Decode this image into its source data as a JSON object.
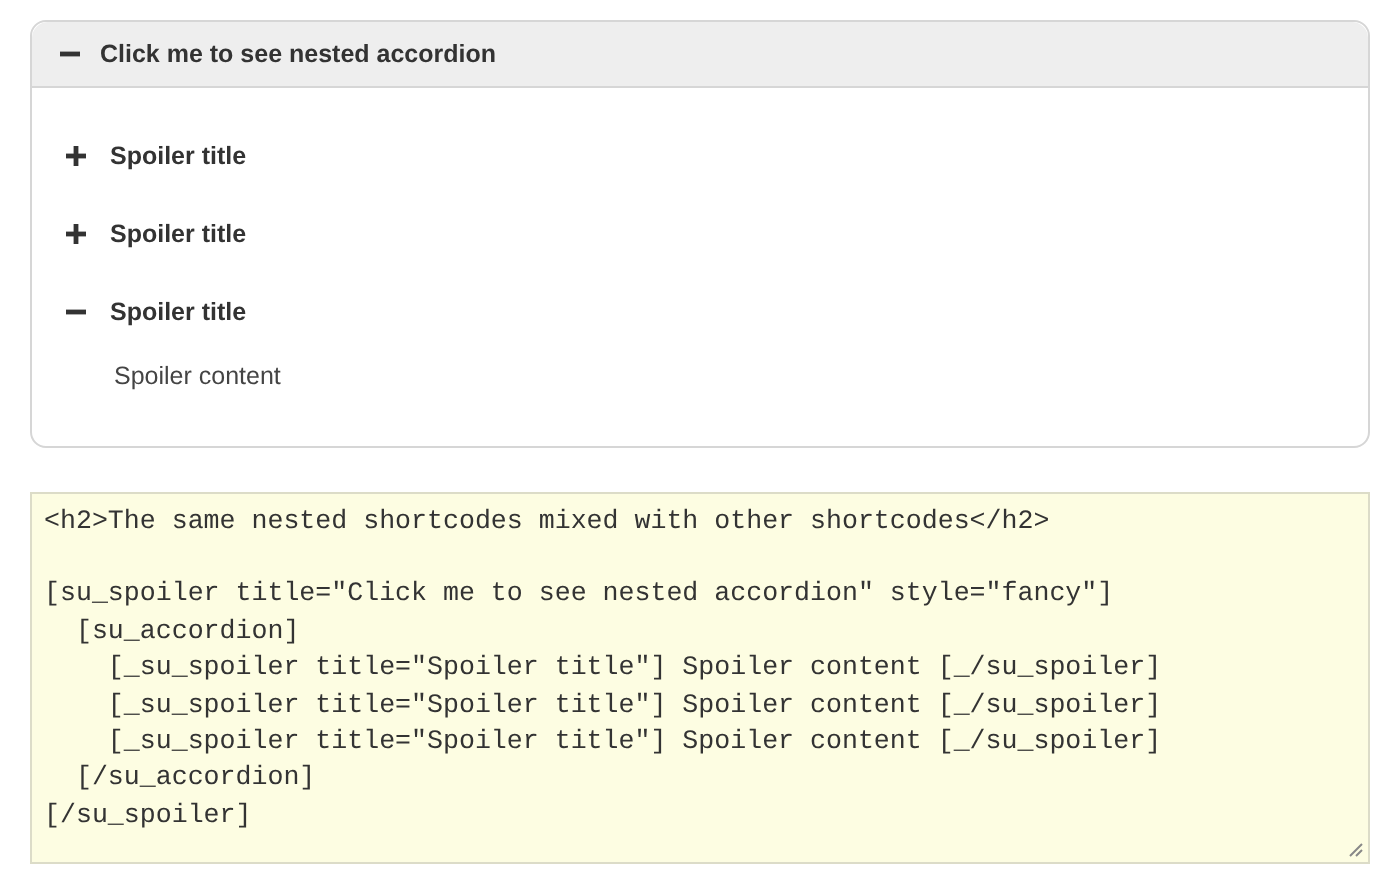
{
  "spoiler": {
    "title": "Click me to see nested accordion",
    "expanded": true,
    "items": [
      {
        "title": "Spoiler title",
        "expanded": false
      },
      {
        "title": "Spoiler title",
        "expanded": false
      },
      {
        "title": "Spoiler title",
        "expanded": true,
        "content": "Spoiler content"
      }
    ]
  },
  "code": {
    "blocks": [
      [
        "<h2>The same nested shortcodes mixed with other shortcodes</h2>"
      ],
      [
        "[su_spoiler title=\"Click me to see nested accordion\" style=\"fancy\"]",
        "  [su_accordion]",
        "    [_su_spoiler title=\"Spoiler title\"] Spoiler content [_/su_spoiler]",
        "    [_su_spoiler title=\"Spoiler title\"] Spoiler content [_/su_spoiler]",
        "    [_su_spoiler title=\"Spoiler title\"] Spoiler content [_/su_spoiler]",
        "  [/su_accordion]",
        "[/su_spoiler]"
      ]
    ]
  }
}
